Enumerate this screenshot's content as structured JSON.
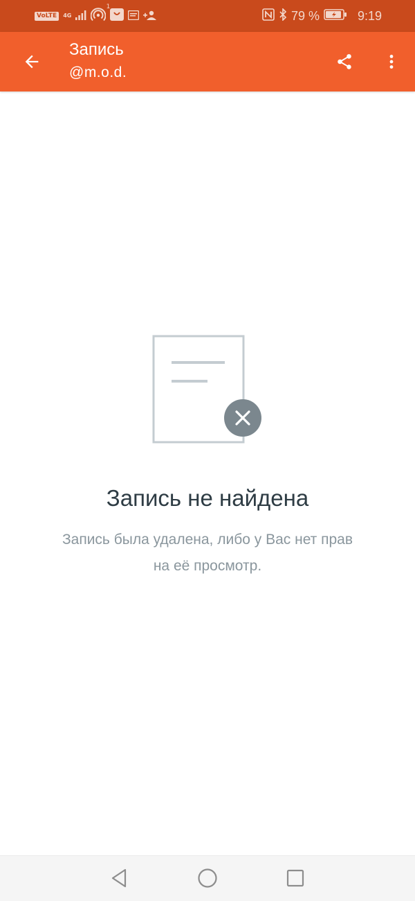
{
  "status_bar": {
    "volte_label": "VoLTE",
    "network_type": "4G",
    "hotspot_count": "1",
    "battery_percent": "79 %",
    "time": "9:19"
  },
  "app_bar": {
    "title": "Запись",
    "subtitle": "@m.o.d.",
    "icons": {
      "back": "arrow-back-icon",
      "share": "share-icon",
      "more": "more-vertical-icon"
    }
  },
  "empty_state": {
    "title": "Запись не найдена",
    "message": "Запись была удалена, либо у Вас нет прав на её просмотр.",
    "icon": "document-removed-icon"
  },
  "nav_bar": {
    "icons": [
      "nav-back-icon",
      "nav-home-icon",
      "nav-recents-icon"
    ]
  },
  "colors": {
    "status_bar": "#c94a1c",
    "app_bar": "#f15f2c",
    "title_text": "#2e3c44",
    "message_text": "#8a969d",
    "illustration_stroke": "#c4ccd1",
    "badge": "#7b878e"
  }
}
